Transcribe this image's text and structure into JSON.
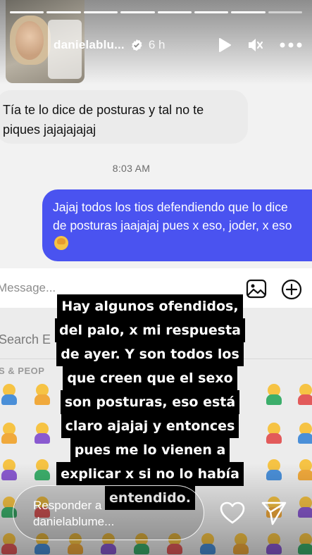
{
  "story": {
    "progress_segments": 8,
    "progress_done": 7,
    "username": "danielablu...",
    "time_ago": "6 h",
    "icons": [
      "verified-badge-icon",
      "play-icon",
      "mute-icon",
      "more-icon"
    ]
  },
  "chat": {
    "incoming_message": "Tía te lo dice de posturas y tal no te piques jajajajajaj",
    "timestamp": "8:03 AM",
    "outgoing_message": "Jajaj todos los tios defendiendo que lo dice de posturas jaajajaj pues x eso, joder, x eso",
    "composer_placeholder": "Message...",
    "keyboard_search": "Search E",
    "keyboard_category": "S & PEOP",
    "accent_color": "#4a53f0"
  },
  "overlay_text": {
    "lines": [
      "Hay algunos ofendidos,",
      "del palo, x mi respuesta",
      "de ayer. Y son todos los",
      "que creen que el sexo",
      "son posturas, eso está",
      "claro ajajaj y entonces",
      "pues me lo vienen a",
      "explicar x si no lo había",
      "entendido."
    ]
  },
  "reply_bar": {
    "placeholder_line1": "Responder a",
    "placeholder_line2": "danielablume..."
  }
}
